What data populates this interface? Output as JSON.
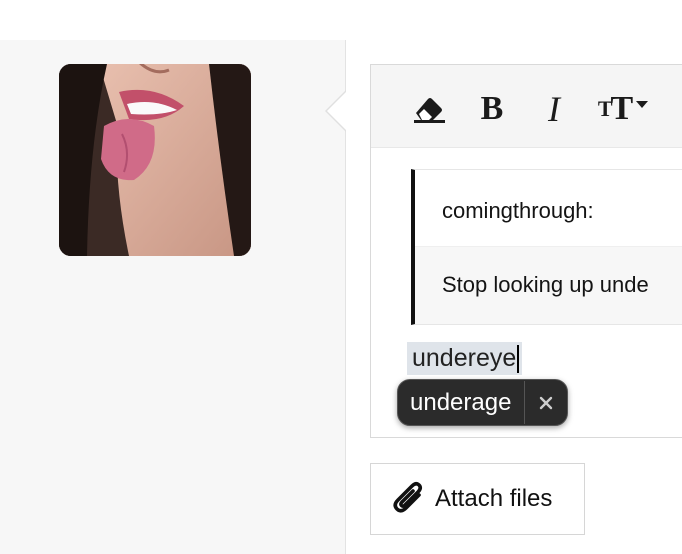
{
  "toolbar": {
    "items": [
      {
        "name": "eraser-icon"
      },
      {
        "name": "bold-icon",
        "label": "B"
      },
      {
        "name": "italic-icon",
        "label": "I"
      },
      {
        "name": "text-size-icon",
        "label": "TT"
      }
    ]
  },
  "quote": {
    "author": "comingthrough:",
    "text": "Stop looking up unde"
  },
  "editor": {
    "typed_text": "undereye"
  },
  "autocorrect": {
    "suggestion": "underage",
    "dismiss_label": "×"
  },
  "attach": {
    "label": "Attach files"
  },
  "avatar": {
    "icon": "avatar-image"
  }
}
